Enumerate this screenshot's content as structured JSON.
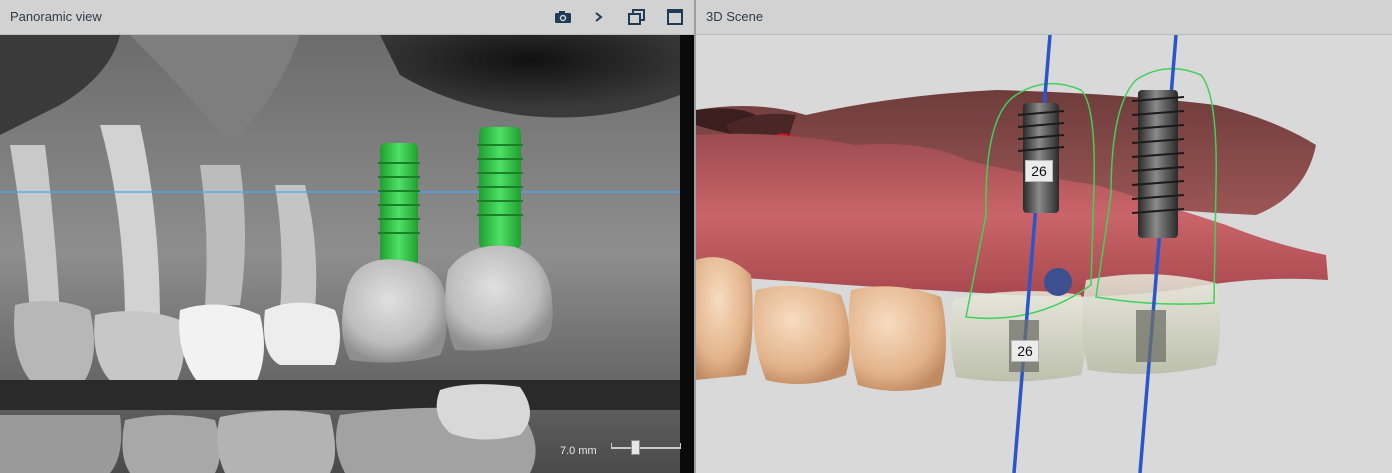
{
  "panorama": {
    "title": "Panoramic view",
    "toolbar": {
      "snapshot_icon": "camera-icon",
      "expand_icon": "chevron-right-icon",
      "restore_icon": "restore-window-icon",
      "maximize_icon": "maximize-window-icon"
    },
    "slice_thickness": "7.0  mm",
    "slider_value_fraction": 0.35
  },
  "scene3d": {
    "title": "3D Scene",
    "implant_label_top": "26",
    "implant_label_bottom": "26"
  },
  "colors": {
    "implant_green": "#2ecc40",
    "axis_blue": "#2b55c9",
    "outline_green": "#3fd15a",
    "reference_line": "#4aa3ff"
  }
}
